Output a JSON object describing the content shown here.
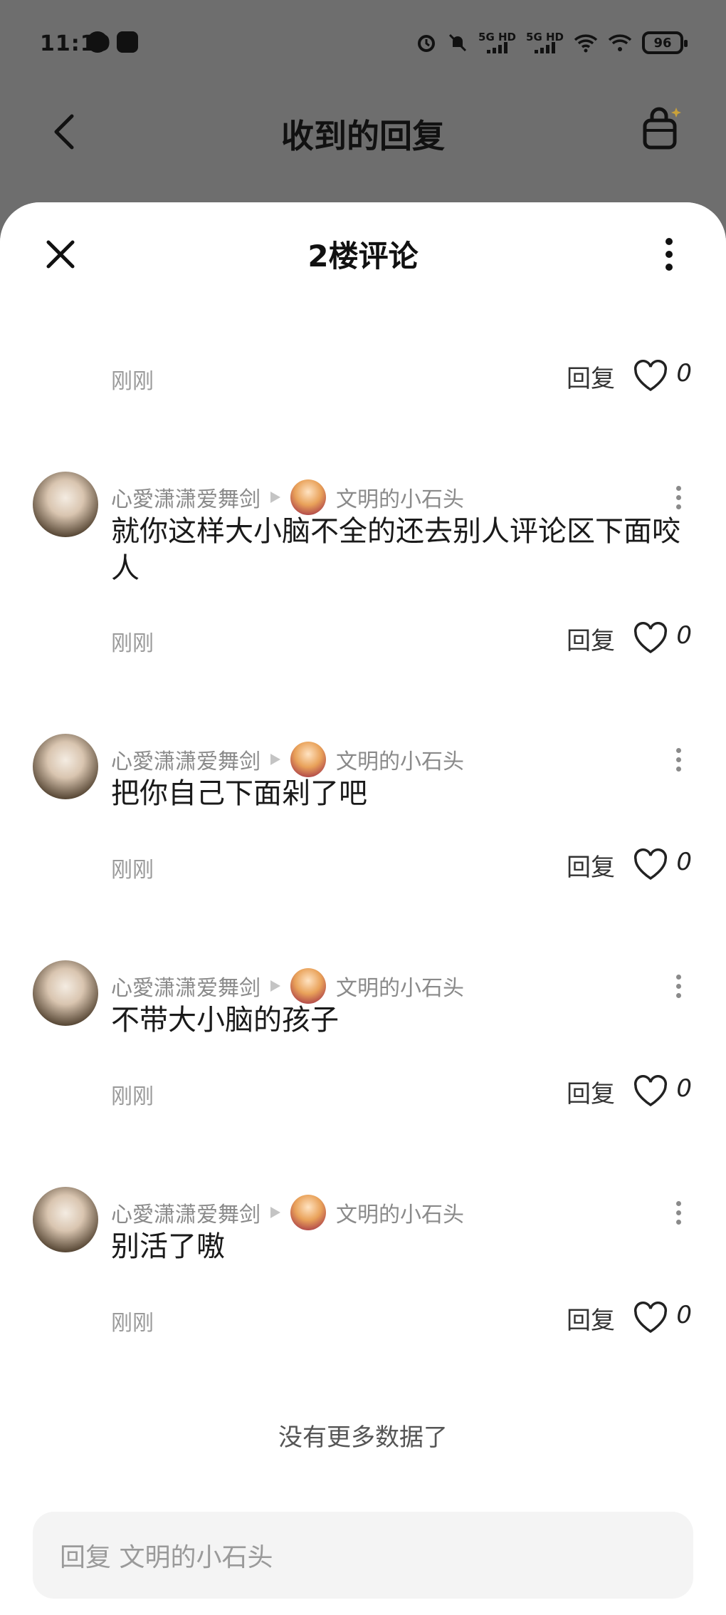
{
  "status_bar": {
    "time": "11:19",
    "net1": "5G HD",
    "net2": "5G HD",
    "battery": "96"
  },
  "header": {
    "title": "收到的回复"
  },
  "sheet": {
    "title": "2楼评论"
  },
  "partial_item": {
    "time": "刚刚",
    "reply_label": "回复",
    "likes": "0"
  },
  "comments": [
    {
      "user": "心愛潇潇爱舞剑",
      "target": "文明的小石头",
      "text": "就你这样大小脑不全的还去别人评论区下面咬人",
      "time": "刚刚",
      "reply_label": "回复",
      "likes": "0"
    },
    {
      "user": "心愛潇潇爱舞剑",
      "target": "文明的小石头",
      "text": "把你自己下面剁了吧",
      "time": "刚刚",
      "reply_label": "回复",
      "likes": "0"
    },
    {
      "user": "心愛潇潇爱舞剑",
      "target": "文明的小石头",
      "text": "不带大小脑的孩子",
      "time": "刚刚",
      "reply_label": "回复",
      "likes": "0"
    },
    {
      "user": "心愛潇潇爱舞剑",
      "target": "文明的小石头",
      "text": "别活了嗷",
      "time": "刚刚",
      "reply_label": "回复",
      "likes": "0"
    }
  ],
  "footer": {
    "no_more": "没有更多数据了",
    "reply_placeholder": "回复 文明的小石头"
  }
}
